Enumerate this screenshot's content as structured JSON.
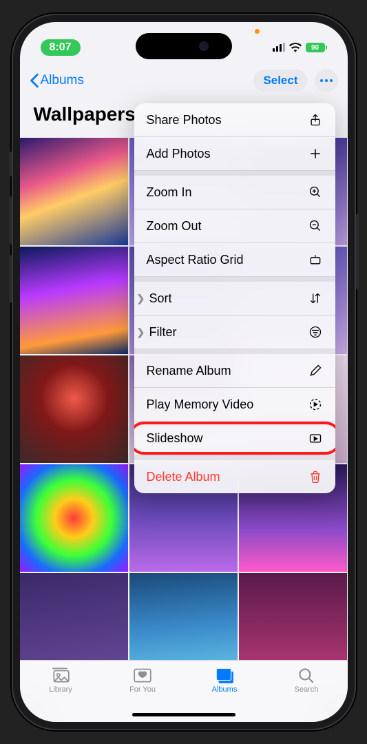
{
  "status": {
    "time": "8:07",
    "battery": "90"
  },
  "nav": {
    "back": "Albums",
    "select": "Select"
  },
  "album": {
    "title": "Wallpapers"
  },
  "menu": {
    "share": "Share Photos",
    "add": "Add Photos",
    "zoomin": "Zoom In",
    "zoomout": "Zoom Out",
    "aspect": "Aspect Ratio Grid",
    "sort": "Sort",
    "filter": "Filter",
    "rename": "Rename Album",
    "memory": "Play Memory Video",
    "slideshow": "Slideshow",
    "delete": "Delete Album"
  },
  "tabs": {
    "library": "Library",
    "foryou": "For You",
    "albums": "Albums",
    "search": "Search"
  }
}
